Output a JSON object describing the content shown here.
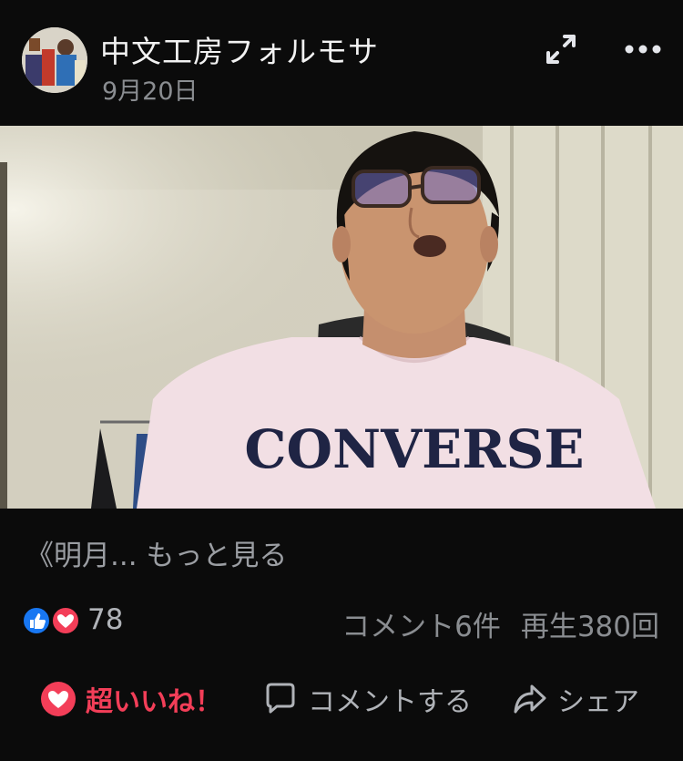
{
  "post": {
    "page_name": "中文工房フォルモサ",
    "date": "9月20日"
  },
  "video": {
    "shirt_text": "CONVERSE"
  },
  "caption": {
    "text": "《明月...",
    "see_more": "もっと見る"
  },
  "stats": {
    "reaction_count": "78",
    "comments": "コメント6件",
    "plays": "再生380回"
  },
  "actions": {
    "love": "超いいね！",
    "comment": "コメントする",
    "share": "シェア"
  },
  "colors": {
    "background": "#0b0b0b",
    "love_red": "#f33e58",
    "like_blue": "#1877f2",
    "muted_text": "#b0b3b8"
  },
  "icons": [
    "expand-icon",
    "more-icon",
    "like-reaction-icon",
    "love-reaction-icon",
    "heart-icon",
    "comment-bubble-icon",
    "share-arrow-icon"
  ]
}
